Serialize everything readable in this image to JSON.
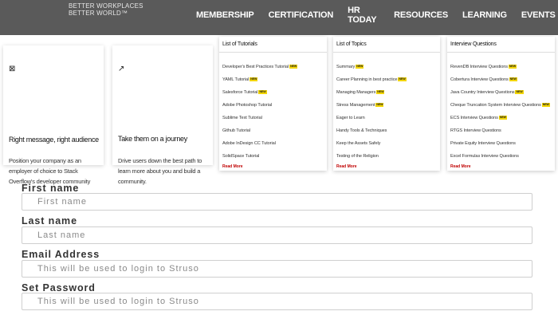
{
  "brand": {
    "line1": "BETTER WORKPLACES",
    "line2": "BETTER WORLD™"
  },
  "nav": {
    "items": [
      "MEMBERSHIP",
      "CERTIFICATION",
      "HR TODAY",
      "RESOURCES",
      "LEARNING",
      "EVENTS"
    ],
    "search_icon": "search-icon"
  },
  "cards": [
    {
      "icon": "⊠",
      "title": "Right message, right audience",
      "body": "Position your company as an employer of choice to Stack Overflow's developer community"
    },
    {
      "icon": "↗",
      "title": "Take them on a journey",
      "body": "Drive users down the best path to learn more about you and build a community."
    }
  ],
  "panels": [
    {
      "heading": "List of Tutorials",
      "items": [
        {
          "label": "Developer's Best Practices Tutorial",
          "new": true
        },
        {
          "label": "YAML Tutorial",
          "new": true
        },
        {
          "label": "Salesforce Tutorial",
          "new": true
        },
        {
          "label": "Adobe Photoshop Tutorial",
          "new": false
        },
        {
          "label": "Sublime Text Tutorial",
          "new": false
        },
        {
          "label": "Github Tutorial",
          "new": false
        },
        {
          "label": "Adobe InDesign CC Tutorial",
          "new": false
        },
        {
          "label": "SolidSpace Tutorial",
          "new": false
        }
      ],
      "read_more": "Read More"
    },
    {
      "heading": "List of Topics",
      "items": [
        {
          "label": "Summary",
          "new": true
        },
        {
          "label": "Career Planning in best practice",
          "new": true
        },
        {
          "label": "Managing Managers",
          "new": true
        },
        {
          "label": "Stress Management",
          "new": true
        },
        {
          "label": "Eager to Learn",
          "new": false
        },
        {
          "label": "Handy Tools & Techniques",
          "new": false
        },
        {
          "label": "Keep the Assets Safely",
          "new": false
        },
        {
          "label": "Testing of the Religion",
          "new": false
        }
      ],
      "read_more": "Read More"
    },
    {
      "heading": "Interview Questions",
      "items": [
        {
          "label": "RevenDB Interview Questions",
          "new": true
        },
        {
          "label": "Cobertura Interview Questions",
          "new": true
        },
        {
          "label": "Java Country Interview Questions",
          "new": true
        },
        {
          "label": "Cheque Truncation System Interview Questions",
          "new": true
        },
        {
          "label": "ECS Interview Questions",
          "new": true
        },
        {
          "label": "RTGS Interview Questions",
          "new": false
        },
        {
          "label": "Private Equity Interview Questions",
          "new": false
        },
        {
          "label": "Excel Formulas Interview Questions",
          "new": false
        }
      ],
      "read_more": "Read More"
    }
  ],
  "new_badge_label": "NEW",
  "form": {
    "first_name": {
      "label": "First name",
      "placeholder": "First name"
    },
    "last_name": {
      "label": "Last name",
      "placeholder": "Last name"
    },
    "email": {
      "label": "Email Address",
      "placeholder": "This will be used to login to Struso"
    },
    "password": {
      "label": "Set Password",
      "placeholder": "This will be used to login to Struso"
    }
  },
  "colors": {
    "topbar": "#5a5a5a",
    "new_badge": "#f2d500",
    "read_more": "#c00000"
  }
}
